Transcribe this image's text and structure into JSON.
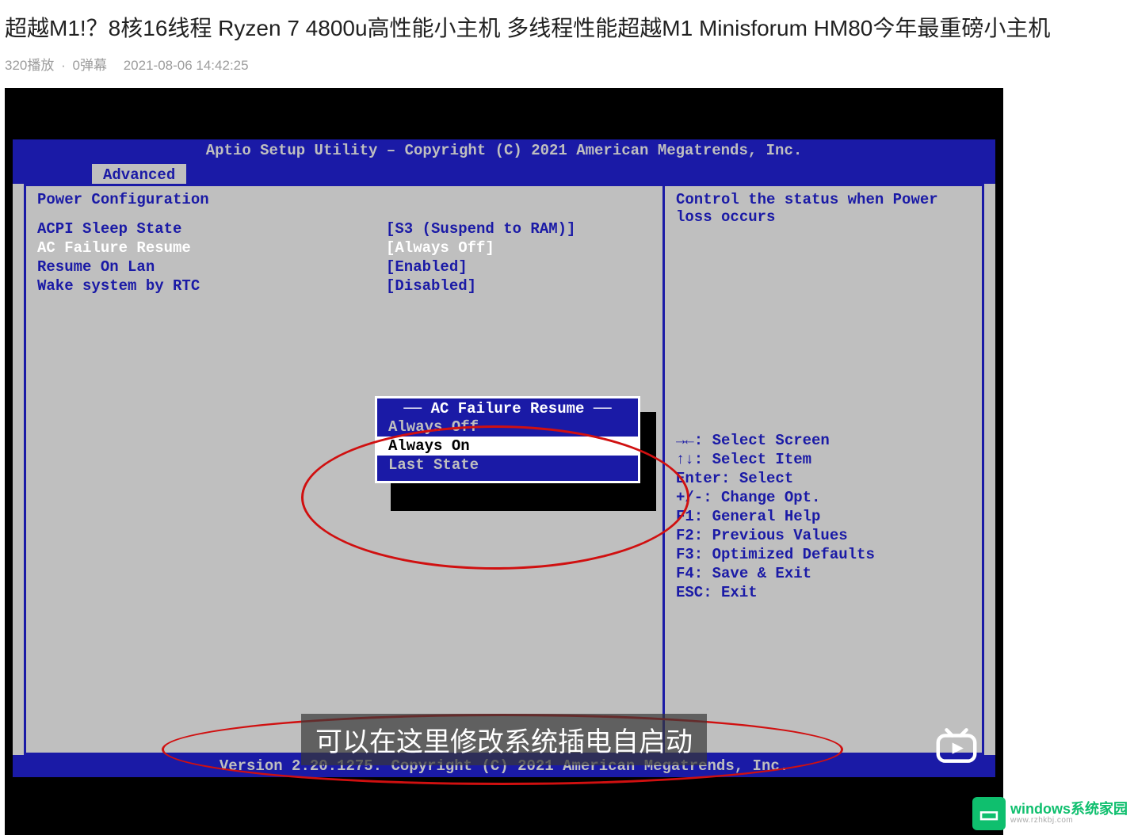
{
  "video": {
    "title": "超越M1!？8核16线程 Ryzen 7 4800u高性能小主机 多线程性能超越M1 Minisforum HM80今年最重磅小主机",
    "plays": "320播放",
    "sep": "·",
    "danmu": "0弹幕",
    "timestamp": "2021-08-06 14:42:25"
  },
  "bios": {
    "header": "Aptio Setup Utility – Copyright (C) 2021 American Megatrends, Inc.",
    "tab": "Advanced",
    "footer": "Version 2.20.1275. Copyright (C) 2021 American Megatrends, Inc.",
    "section": "Power Configuration",
    "description": "Control the status when Power loss occurs",
    "options": [
      {
        "label": "ACPI Sleep State",
        "value": "[S3 (Suspend to RAM)]",
        "highlight": false
      },
      {
        "label": "AC Failure Resume",
        "value": "[Always Off]",
        "highlight": true
      },
      {
        "label": "Resume On Lan",
        "value": "[Enabled]",
        "highlight": false
      },
      {
        "label": "Wake system by RTC",
        "value": "[Disabled]",
        "highlight": false
      }
    ],
    "help": [
      "→←: Select Screen",
      "↑↓: Select Item",
      "Enter: Select",
      "+/-: Change Opt.",
      "F1: General Help",
      "F2: Previous Values",
      "F3: Optimized Defaults",
      "F4: Save & Exit",
      "ESC: Exit"
    ]
  },
  "popup": {
    "title": "AC Failure Resume",
    "items": [
      "Always Off",
      "Always On",
      "Last State"
    ],
    "selected": 1
  },
  "subtitle": "可以在这里修改系统插电自启动",
  "watermark": {
    "line1": "windows系统家园",
    "line2": "www.rzhkbj.com"
  }
}
